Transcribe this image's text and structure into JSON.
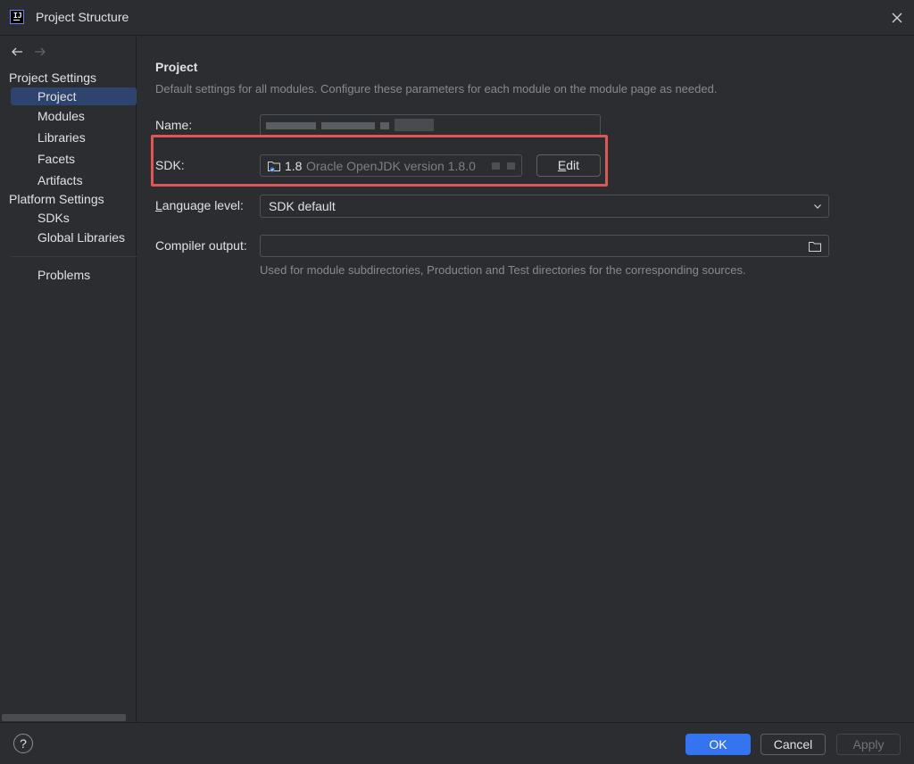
{
  "window": {
    "title": "Project Structure"
  },
  "sidebar": {
    "project_settings_title": "Project Settings",
    "project_settings_items": [
      {
        "label": "Project",
        "selected": true
      },
      {
        "label": "Modules"
      },
      {
        "label": "Libraries"
      },
      {
        "label": "Facets"
      },
      {
        "label": "Artifacts"
      }
    ],
    "platform_settings_title": "Platform Settings",
    "platform_settings_items": [
      {
        "label": "SDKs"
      },
      {
        "label": "Global Libraries"
      }
    ],
    "problems_label": "Problems"
  },
  "main": {
    "heading": "Project",
    "description": "Default settings for all modules. Configure these parameters for each module on the module page as needed.",
    "name_label": "Name:",
    "sdk": {
      "label": "SDK:",
      "version": "1.8",
      "description": "Oracle OpenJDK version 1.8.0",
      "edit_label_prefix": "",
      "edit_mnemonic": "E",
      "edit_label_rest": "dit"
    },
    "language_level": {
      "label_mnemonic": "L",
      "label_rest": "anguage level:",
      "value": "SDK default"
    },
    "compiler_output": {
      "label": "Compiler output:",
      "value": "",
      "hint": "Used for module subdirectories, Production and Test directories for the corresponding sources."
    }
  },
  "footer": {
    "help": "?",
    "ok": "OK",
    "cancel": "Cancel",
    "apply": "Apply"
  },
  "colors": {
    "accent": "#3574f0",
    "highlight": "#e05555",
    "selection": "#2e436e"
  }
}
